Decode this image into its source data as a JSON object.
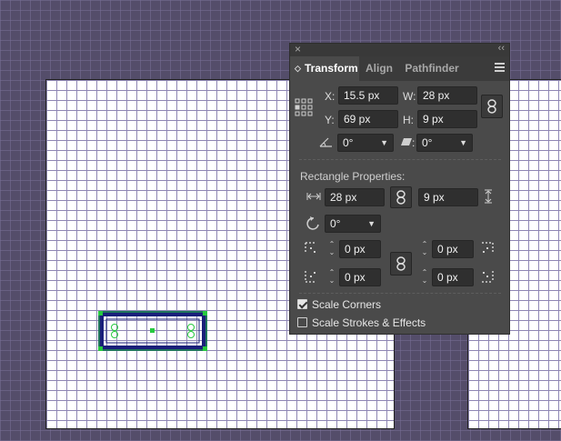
{
  "panel": {
    "close_glyph": "×",
    "collapse_glyph": "‹‹",
    "tabs": [
      {
        "label": "Transform",
        "active": true
      },
      {
        "label": "Align",
        "active": false
      },
      {
        "label": "Pathfinder",
        "active": false
      }
    ],
    "transform": {
      "x_label": "X:",
      "x_value": "15.5 px",
      "y_label": "Y:",
      "y_value": "69 px",
      "w_label": "W:",
      "w_value": "28 px",
      "h_label": "H:",
      "h_value": "9 px",
      "angle_value": "0°",
      "shear_value": "0°"
    },
    "rectangle_properties": {
      "title": "Rectangle Properties:",
      "width_value": "28 px",
      "height_value": "9 px",
      "rotation_value": "0°",
      "corners": {
        "top_left": "0 px",
        "top_right": "0 px",
        "bottom_left": "0 px",
        "bottom_right": "0 px"
      }
    },
    "options": {
      "scale_corners": {
        "label": "Scale Corners",
        "checked": true
      },
      "scale_strokes": {
        "label": "Scale Strokes & Effects",
        "checked": false
      }
    }
  },
  "colors": {
    "canvas": "#544d6a",
    "artboard": "#ffffff",
    "grid": "#8e86b4",
    "shape_stroke": "#1a1f7a",
    "selection": "#27c93f",
    "panel_bg": "#4a4a4a"
  },
  "icons": [
    "reference-point-icon",
    "link-icon",
    "angle-icon",
    "shear-icon",
    "width-icon",
    "height-icon",
    "rotate-icon",
    "corner-icon",
    "menu-icon",
    "checkbox-icon"
  ]
}
